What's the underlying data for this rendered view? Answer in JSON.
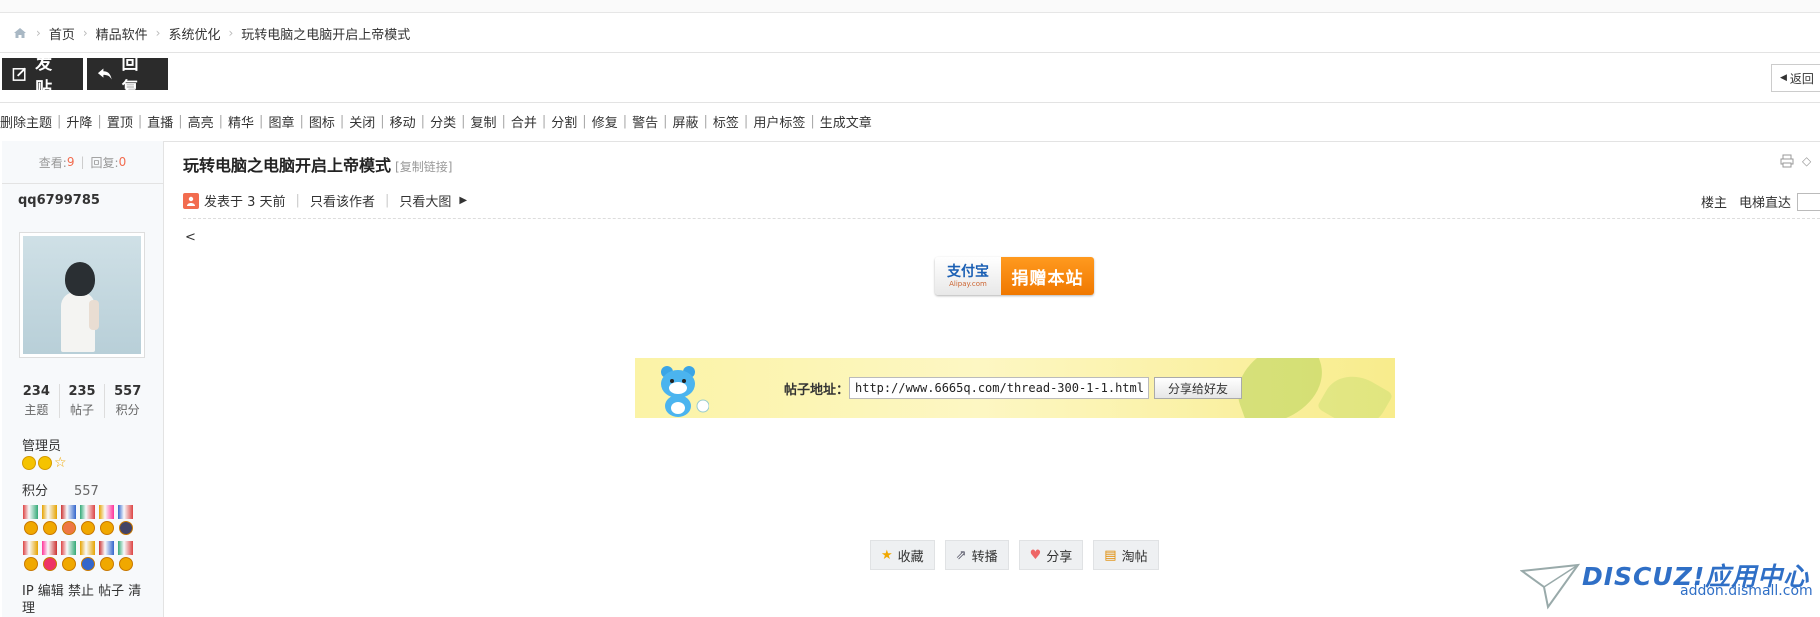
{
  "breadcrumb": {
    "items": [
      "首页",
      "精品软件",
      "系统优化",
      "玩转电脑之电脑开启上帝模式"
    ]
  },
  "buttons": {
    "post": "发贴",
    "reply": "回复",
    "back": "返回"
  },
  "admin_tools": [
    "删除主题",
    "升降",
    "置顶",
    "直播",
    "高亮",
    "精华",
    "图章",
    "图标",
    "关闭",
    "移动",
    "分类",
    "复制",
    "合并",
    "分割",
    "修复",
    "警告",
    "屏蔽",
    "标签",
    "用户标签",
    "生成文章"
  ],
  "stats": {
    "views_label": "查看:",
    "views": "9",
    "replies_label": "回复:",
    "replies": "0"
  },
  "author": {
    "name": "qq6799785",
    "topics": "234",
    "topics_label": "主题",
    "posts": "235",
    "posts_label": "帖子",
    "credits": "557",
    "credits_label": "积分",
    "group": "管理员",
    "credit_label": "积分",
    "credit_value": "557",
    "mod_links": "IP 编辑 禁止 帖子 清理"
  },
  "post": {
    "title": "玩转电脑之电脑开启上帝模式",
    "copy_link": "[复制链接]",
    "posted": "发表于 3 天前",
    "only_author": "只看该作者",
    "big_image": "只看大图",
    "floor": "楼主",
    "jump": "电梯直达",
    "body_text": "<"
  },
  "donate": {
    "brand": "支付宝",
    "brand_sub": "Alipay.com",
    "label": "捐赠本站"
  },
  "share": {
    "label": "帖子地址：",
    "url": "http://www.6665q.com/thread-300-1-1.html",
    "button": "分享给好友"
  },
  "actions": [
    {
      "label": "收藏",
      "icon": "star-icon"
    },
    {
      "label": "转播",
      "icon": "forward-icon"
    },
    {
      "label": "分享",
      "icon": "heart-icon"
    },
    {
      "label": "淘帖",
      "icon": "collection-icon"
    }
  ],
  "watermark": {
    "logo": "DISCUZ!应用中心",
    "domain": "addon.dismall.com"
  }
}
